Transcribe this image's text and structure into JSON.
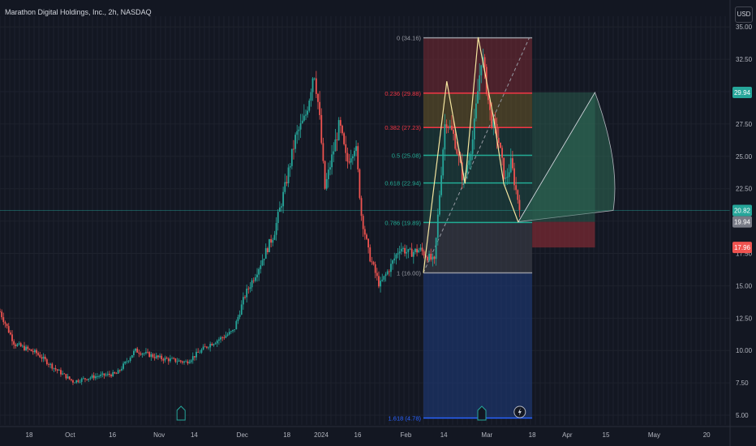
{
  "window": {
    "title": "Marathon Digital Holdings, Inc., 2h, NASDAQ",
    "currency": "USD"
  },
  "colors": {
    "background": "#131722",
    "grid": "#1e222d",
    "candle_up": "#26a69a",
    "candle_down": "#ef5350",
    "fib_top_zone": "#7a2a33",
    "fib_mid_zone": "#6b5a2a",
    "fib_green_zone": "#1f4d45",
    "fib_grey_zone": "#3d4049",
    "fib_blue_zone": "#1e3a7a",
    "projection_green": "#2f6b56",
    "projection_red": "#7a2a33",
    "pattern_line": "#f5e6a0"
  },
  "icons": {
    "earnings": "earnings-e-icon",
    "split": "lightning-icon"
  },
  "chart_data": {
    "type": "candlestick",
    "title": "Marathon Digital Holdings, Inc., 2h, NASDAQ",
    "ylim": [
      4.5,
      35.2
    ],
    "y_ticks": [
      "5.00",
      "7.50",
      "10.00",
      "12.50",
      "15.00",
      "17.50",
      "20.00",
      "22.50",
      "25.00",
      "27.50",
      "30.00",
      "32.50",
      "35.00"
    ],
    "y_tick_values": [
      5,
      7.5,
      10,
      12.5,
      15,
      17.5,
      20,
      22.5,
      25,
      27.5,
      30,
      32.5,
      35
    ],
    "x_ticks": [
      "18",
      "Oct",
      "16",
      "Nov",
      "14",
      "Dec",
      "18",
      "2024",
      "16",
      "Feb",
      "14",
      "Mar",
      "18",
      "Apr",
      "15",
      "May",
      "20"
    ],
    "x_tick_positions": [
      0.04,
      0.096,
      0.154,
      0.218,
      0.266,
      0.332,
      0.393,
      0.44,
      0.49,
      0.556,
      0.608,
      0.667,
      0.729,
      0.777,
      0.83,
      0.896,
      0.968
    ],
    "price_badges": [
      {
        "label": "29.94",
        "value": 29.94,
        "color": "#26a69a"
      },
      {
        "label": "20.82",
        "value": 20.82,
        "color": "#26a69a"
      },
      {
        "label": "19.94",
        "value": 19.94,
        "color": "#787b86"
      },
      {
        "label": "17.96",
        "value": 17.96,
        "color": "#ef5350"
      }
    ],
    "current_price": 20.82,
    "fib_levels": [
      {
        "label": "0 (34.16)",
        "value": 34.16,
        "color": "#9598a1"
      },
      {
        "label": "0.236 (29.88)",
        "value": 29.88,
        "color": "#f23645"
      },
      {
        "label": "0.382 (27.23)",
        "value": 27.23,
        "color": "#f23645"
      },
      {
        "label": "0.5 (25.08)",
        "value": 25.08,
        "color": "#22ab94"
      },
      {
        "label": "0.618 (22.94)",
        "value": 22.94,
        "color": "#22ab94"
      },
      {
        "label": "0.786 (19.89)",
        "value": 19.89,
        "color": "#22ab94"
      },
      {
        "label": "1 (16.00)",
        "value": 16.0,
        "color": "#9598a1"
      },
      {
        "label": "1.618 (4.78)",
        "value": 4.78,
        "color": "#2962ff"
      }
    ],
    "price_path": [
      [
        0.0,
        13.0
      ],
      [
        0.02,
        10.5
      ],
      [
        0.05,
        9.8
      ],
      [
        0.075,
        8.6
      ],
      [
        0.1,
        7.6
      ],
      [
        0.13,
        8.0
      ],
      [
        0.16,
        8.2
      ],
      [
        0.185,
        10.0
      ],
      [
        0.22,
        9.4
      ],
      [
        0.255,
        9.1
      ],
      [
        0.285,
        10.4
      ],
      [
        0.32,
        11.5
      ],
      [
        0.335,
        14.2
      ],
      [
        0.355,
        16.5
      ],
      [
        0.375,
        19.0
      ],
      [
        0.39,
        22.5
      ],
      [
        0.405,
        26.5
      ],
      [
        0.418,
        28.0
      ],
      [
        0.425,
        30.0
      ],
      [
        0.43,
        31.8
      ],
      [
        0.437,
        28.5
      ],
      [
        0.445,
        22.5
      ],
      [
        0.455,
        25.0
      ],
      [
        0.465,
        27.5
      ],
      [
        0.475,
        24.5
      ],
      [
        0.487,
        26.0
      ],
      [
        0.495,
        20.5
      ],
      [
        0.505,
        17.5
      ],
      [
        0.52,
        15.0
      ],
      [
        0.535,
        16.5
      ],
      [
        0.548,
        18.0
      ],
      [
        0.56,
        17.5
      ],
      [
        0.575,
        17.8
      ],
      [
        0.595,
        16.8
      ],
      [
        0.61,
        28.0
      ],
      [
        0.622,
        26.5
      ],
      [
        0.635,
        23.0
      ],
      [
        0.648,
        26.5
      ],
      [
        0.66,
        33.0
      ],
      [
        0.672,
        28.0
      ],
      [
        0.682,
        26.5
      ],
      [
        0.692,
        23.0
      ],
      [
        0.7,
        24.5
      ],
      [
        0.708,
        22.0
      ],
      [
        0.714,
        20.8
      ]
    ],
    "pattern": [
      [
        0.58,
        16.0
      ],
      [
        0.612,
        30.8
      ],
      [
        0.637,
        22.9
      ],
      [
        0.655,
        34.2
      ],
      [
        0.676,
        28.0
      ],
      [
        0.69,
        22.9
      ],
      [
        0.71,
        19.9
      ]
    ],
    "projection_target": {
      "x": 0.815,
      "y": 29.94
    },
    "earnings_markers": [
      0.248,
      0.66
    ],
    "split_marker": 0.712
  }
}
